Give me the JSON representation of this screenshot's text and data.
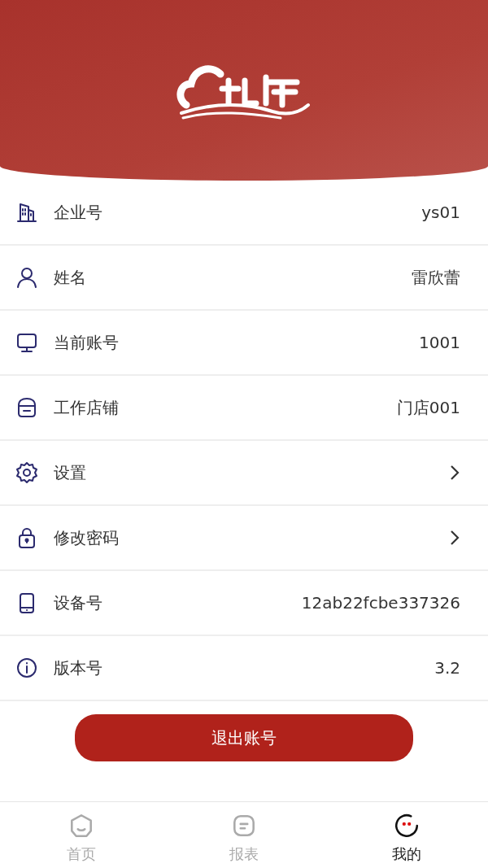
{
  "rows": [
    {
      "label": "企业号",
      "value": "ys01",
      "kind": "value"
    },
    {
      "label": "姓名",
      "value": "雷欣蕾",
      "kind": "value"
    },
    {
      "label": "当前账号",
      "value": "1001",
      "kind": "value"
    },
    {
      "label": "工作店铺",
      "value": "门店001",
      "kind": "value"
    },
    {
      "label": "设置",
      "kind": "link"
    },
    {
      "label": "修改密码",
      "kind": "link"
    },
    {
      "label": "设备号",
      "value": "12ab22fcbe337326",
      "kind": "value"
    },
    {
      "label": "版本号",
      "value": "3.2",
      "kind": "value"
    }
  ],
  "logout_button": "退出账号",
  "tabs": [
    {
      "label": "首页",
      "selected": false
    },
    {
      "label": "报表",
      "selected": false
    },
    {
      "label": "我的",
      "selected": true
    }
  ]
}
